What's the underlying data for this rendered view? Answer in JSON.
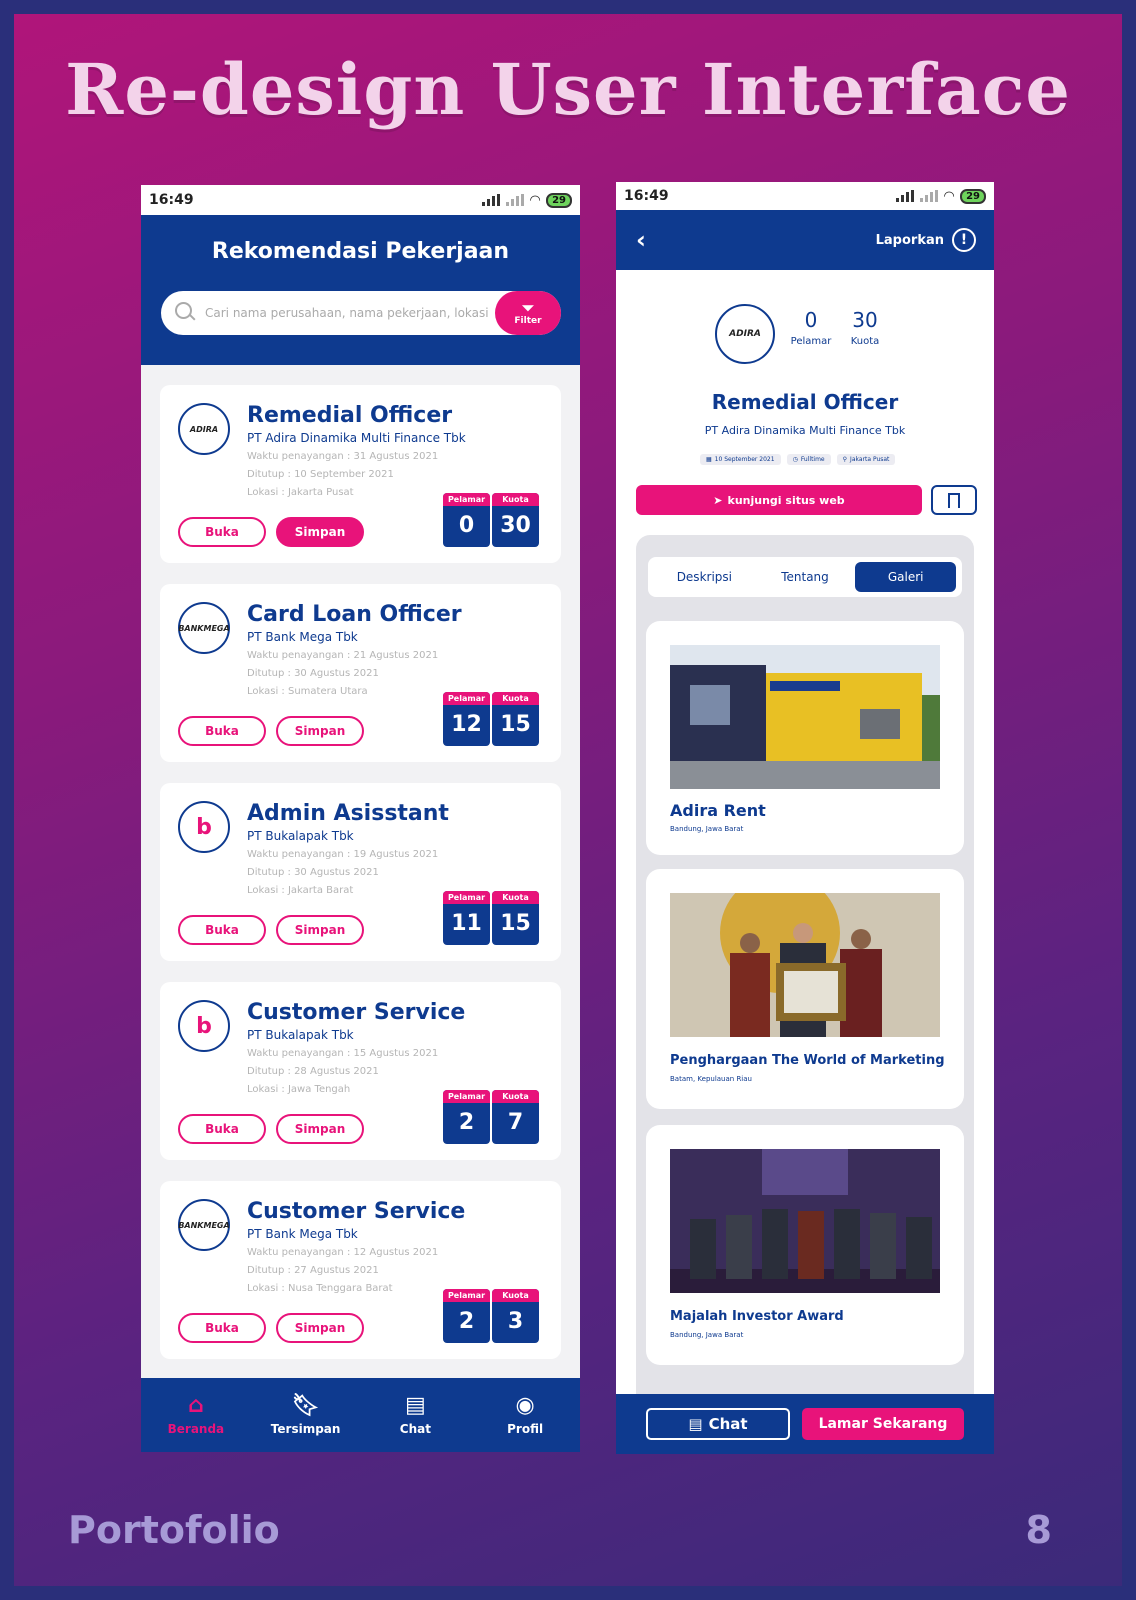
{
  "headline": "Re-design User Interface",
  "footer": {
    "brand": "Portofolio",
    "page": "8"
  },
  "colors": {
    "brand_blue": "#0e3a8f",
    "accent_pink": "#e8137a"
  },
  "left_phone": {
    "status": {
      "time": "16:49",
      "battery": "29"
    },
    "title": "Rekomendasi Pekerjaan",
    "search_placeholder": "Cari nama perusahaan, nama pekerjaan, lokasi",
    "filter_label": "Filter",
    "stat_labels": {
      "applicants": "Pelamar",
      "quota": "Kuota"
    },
    "buttons": {
      "open": "Buka",
      "save": "Simpan"
    },
    "jobs": [
      {
        "title": "Remedial Officer",
        "company": "PT Adira Dinamika Multi Finance Tbk",
        "logo": "ADIRA",
        "posted": "Waktu penayangan : 31 Agustus 2021",
        "closes": "Ditutup : 10 September 2021",
        "location": "Lokasi : Jakarta Pusat",
        "applicants": "0",
        "quota": "30"
      },
      {
        "title": "Card Loan Officer",
        "company": "PT Bank Mega Tbk",
        "logo": "BANKMEGA",
        "posted": "Waktu penayangan : 21 Agustus 2021",
        "closes": "Ditutup : 30 Agustus 2021",
        "location": "Lokasi : Sumatera Utara",
        "applicants": "12",
        "quota": "15"
      },
      {
        "title": "Admin Asisstant",
        "company": "PT Bukalapak Tbk",
        "logo": "b",
        "posted": "Waktu penayangan : 19 Agustus 2021",
        "closes": "Ditutup : 30 Agustus 2021",
        "location": "Lokasi : Jakarta Barat",
        "applicants": "11",
        "quota": "15"
      },
      {
        "title": "Customer Service",
        "company": "PT Bukalapak Tbk",
        "logo": "b",
        "posted": "Waktu penayangan : 15 Agustus 2021",
        "closes": "Ditutup : 28 Agustus 2021",
        "location": "Lokasi : Jawa Tengah",
        "applicants": "2",
        "quota": "7"
      },
      {
        "title": "Customer Service",
        "company": "PT Bank Mega Tbk",
        "logo": "BANKMEGA",
        "posted": "Waktu penayangan : 12 Agustus 2021",
        "closes": "Ditutup : 27 Agustus 2021",
        "location": "Lokasi : Nusa Tenggara Barat",
        "applicants": "2",
        "quota": "3"
      }
    ],
    "nav": [
      {
        "label": "Beranda",
        "icon": "home-icon"
      },
      {
        "label": "Tersimpan",
        "icon": "bookmark-icon"
      },
      {
        "label": "Chat",
        "icon": "chat-icon"
      },
      {
        "label": "Profil",
        "icon": "profile-icon"
      }
    ]
  },
  "right_phone": {
    "status": {
      "time": "16:49",
      "battery": "29"
    },
    "report_label": "Laporkan",
    "logo": "ADIRA",
    "applicants": {
      "value": "0",
      "label": "Pelamar"
    },
    "quota": {
      "value": "30",
      "label": "Kuota"
    },
    "title": "Remedial Officer",
    "company": "PT Adira Dinamika Multi Finance Tbk",
    "chips": [
      "10 September 2021",
      "Fulltime",
      "Jakarta Pusat"
    ],
    "visit_label": "kunjungi situs web",
    "tabs": [
      "Deskripsi",
      "Tentang",
      "Galeri"
    ],
    "gallery": [
      {
        "name": "Adira Rent",
        "location": "Bandung, Jawa Barat"
      },
      {
        "name": "Penghargaan The World of Marketing",
        "location": "Batam, Kepulauan Riau"
      },
      {
        "name": "Majalah Investor Award",
        "location": "Bandung, Jawa Barat"
      }
    ],
    "chat_label": "Chat",
    "apply_label": "Lamar Sekarang"
  }
}
